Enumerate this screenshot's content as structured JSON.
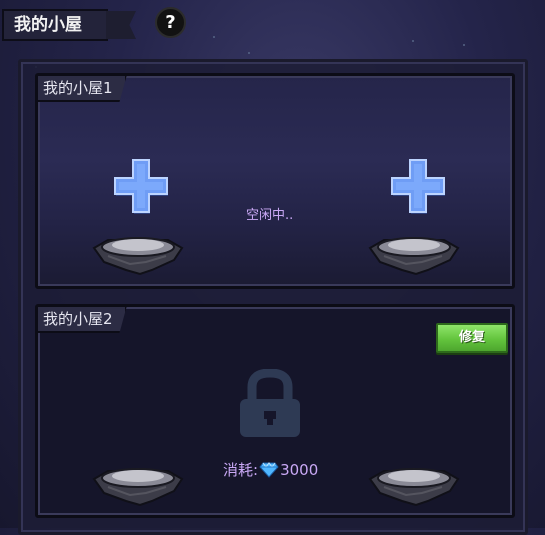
{
  "header": {
    "title": "我的小屋",
    "help_icon_label": "?"
  },
  "rooms": [
    {
      "label": "我的小屋1",
      "status": "空闲中.."
    },
    {
      "label": "我的小屋2",
      "repair_label": "修复",
      "cost_label": "消耗:",
      "cost_value": "3000",
      "cost_icon": "diamond-icon"
    }
  ],
  "colors": {
    "accent_text": "#c9a8f5",
    "repair_green": "#63c43d",
    "plus_blue": "#6f9df5"
  }
}
